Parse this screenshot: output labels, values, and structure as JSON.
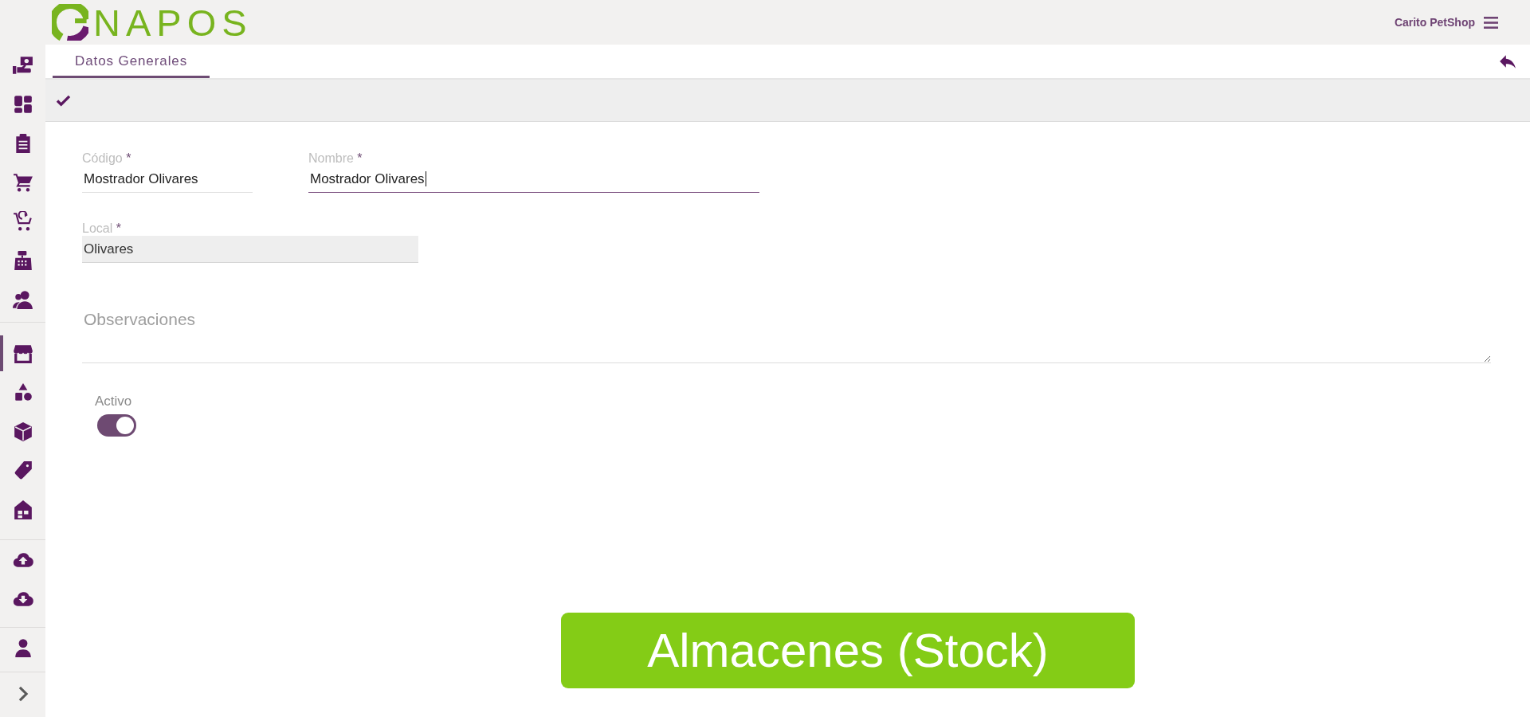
{
  "header": {
    "logo_text": "NAPOS",
    "company": "Carito PetShop"
  },
  "sidebar": {
    "groups": [
      {
        "items": [
          {
            "selected": false
          },
          {
            "selected": false
          },
          {
            "selected": false
          },
          {
            "selected": false
          },
          {
            "selected": false
          },
          {
            "selected": false
          },
          {
            "selected": false
          }
        ]
      },
      {
        "items": [
          {
            "selected": true
          },
          {
            "selected": false
          },
          {
            "selected": false
          },
          {
            "selected": false
          },
          {
            "selected": false
          }
        ]
      },
      {
        "items": [
          {
            "selected": false
          },
          {
            "selected": false
          }
        ]
      },
      {
        "items": [
          {
            "selected": false
          }
        ]
      }
    ]
  },
  "tabs": [
    {
      "label": "Datos Generales",
      "selected": true
    }
  ],
  "form": {
    "rows": [
      {
        "fields": [
          {
            "kind": "text",
            "label": "Código",
            "required_mark": "*",
            "value": "Mostrador Olivares",
            "focused": false,
            "disabled": false
          },
          {
            "kind": "text",
            "label": "Nombre",
            "required_mark": "*",
            "value": "Mostrador Olivares",
            "focused": true,
            "disabled": false
          }
        ]
      },
      {
        "fields": [
          {
            "kind": "text",
            "label": "Local",
            "required_mark": "*",
            "value": "Olivares",
            "focused": false,
            "disabled": true
          }
        ]
      },
      {
        "fields": [
          {
            "kind": "textarea",
            "placeholder": "Observaciones"
          }
        ]
      },
      {
        "fields": [
          {
            "kind": "toggle",
            "label": "Activo",
            "on": true
          }
        ]
      }
    ]
  },
  "caption": "Almacenes (Stock)"
}
